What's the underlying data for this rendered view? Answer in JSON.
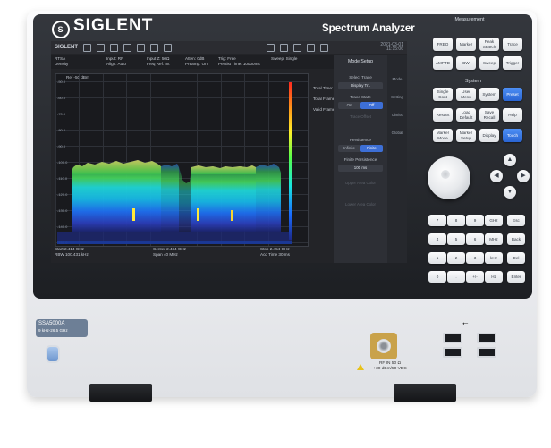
{
  "device": {
    "brand": "SIGLENT",
    "product_name": "Spectrum Analyzer",
    "model": "SSA5000A",
    "model_range": "9 kHz-26.5 GHz"
  },
  "screen": {
    "toolbar_brand": "SIGLENT",
    "toolbar_time": [
      "2021-03-01",
      "11:15:06"
    ],
    "info": {
      "mode": "RTSA",
      "view": "Density",
      "input_rf": "Input: RF",
      "input_align": "Align: Auto",
      "input_z": "Input Z: 50Ω",
      "freq_ref": "Freq Ref: Int",
      "atten": "Atten: 0dB",
      "preamp": "Preamp: On",
      "trig": "Trig: Free",
      "persist": "Persist Time: 10000ms",
      "sweep": "Sweep: Single"
    },
    "ref_level": "Ref -50 dBm",
    "y_ticks": [
      "-50.0",
      "-60.0",
      "-70.0",
      "-80.0",
      "-90.0",
      "-100.0",
      "-110.0",
      "-120.0",
      "-130.0",
      "-140.0",
      "-150.0"
    ],
    "stats": {
      "total_time_label": "Total Time:",
      "total_time_value": "3h5m58.1 s",
      "total_frames_label": "Total Frames:",
      "total_frames_value": "110000",
      "valid_frames_label": "Valid Frames:",
      "valid_frames_value": "110000"
    },
    "menu": {
      "title": "Mode Setup",
      "select_trace_label": "Select Trace",
      "select_trace_value": "Display Tr1",
      "trace_state_label": "Trace State",
      "trace_state_options": [
        "On",
        "Off"
      ],
      "trace_offset": "Trace Offset",
      "persistence_label": "Persistence",
      "persistence_options": [
        "Infinite",
        "Finite"
      ],
      "finite_persistence_label": "Finite Persistence",
      "finite_persistence_value": "100 ms",
      "upper_label": "Upper Area Color",
      "lower_label": "Lower Area Color"
    },
    "side_tabs": [
      "Mode",
      "Setting",
      "Limits",
      "Global"
    ],
    "footer": {
      "start": "Start 2.414 GHz",
      "rbw": "RBW 100.431 kHz",
      "center": "Center 2.434 GHz",
      "span": "Span 40 MHz",
      "stop": "Stop 2.454 GHz",
      "acq": "Acq Time 30 ms"
    }
  },
  "front_panel": {
    "measurement_label": "Measurement",
    "measurement_keys": [
      "FREQ",
      "Marker",
      "Peak Search",
      "Trace",
      "AMPTD",
      "BW",
      "Sweep",
      "Trigger"
    ],
    "mode_keys": [
      "Mode",
      "Meas",
      "Meas Setup"
    ],
    "system_label": "System",
    "system_keys": [
      "Single Cont",
      "User Menu",
      "System",
      "Preset",
      "Restart",
      "Load Default",
      "Save Recall",
      "Help",
      "Marker Mode",
      "Marker Setup",
      "Display",
      "Touch"
    ],
    "num_keys": [
      "7",
      "8",
      "9",
      "GHz",
      "Esc",
      "4",
      "5",
      "6",
      "MHz",
      "Back",
      "1",
      "2",
      "3",
      "kHz",
      "Del",
      "0",
      ".",
      "+/-",
      "Hz",
      "Enter"
    ],
    "arrows": [
      "▲",
      "◀",
      "▶",
      "▼"
    ]
  },
  "lower_panel": {
    "rf_in": "RF IN 50 Ω",
    "rf_limit": "+30 dBm/50 VDC",
    "usb_symbol": "⭠"
  },
  "colors": {
    "bezel": "#1d1f23",
    "screen_bg": "#232428",
    "accent_blue": "#2a65d3",
    "rf_gold": "#c9a24a",
    "model_plate": "#6d7f96"
  }
}
